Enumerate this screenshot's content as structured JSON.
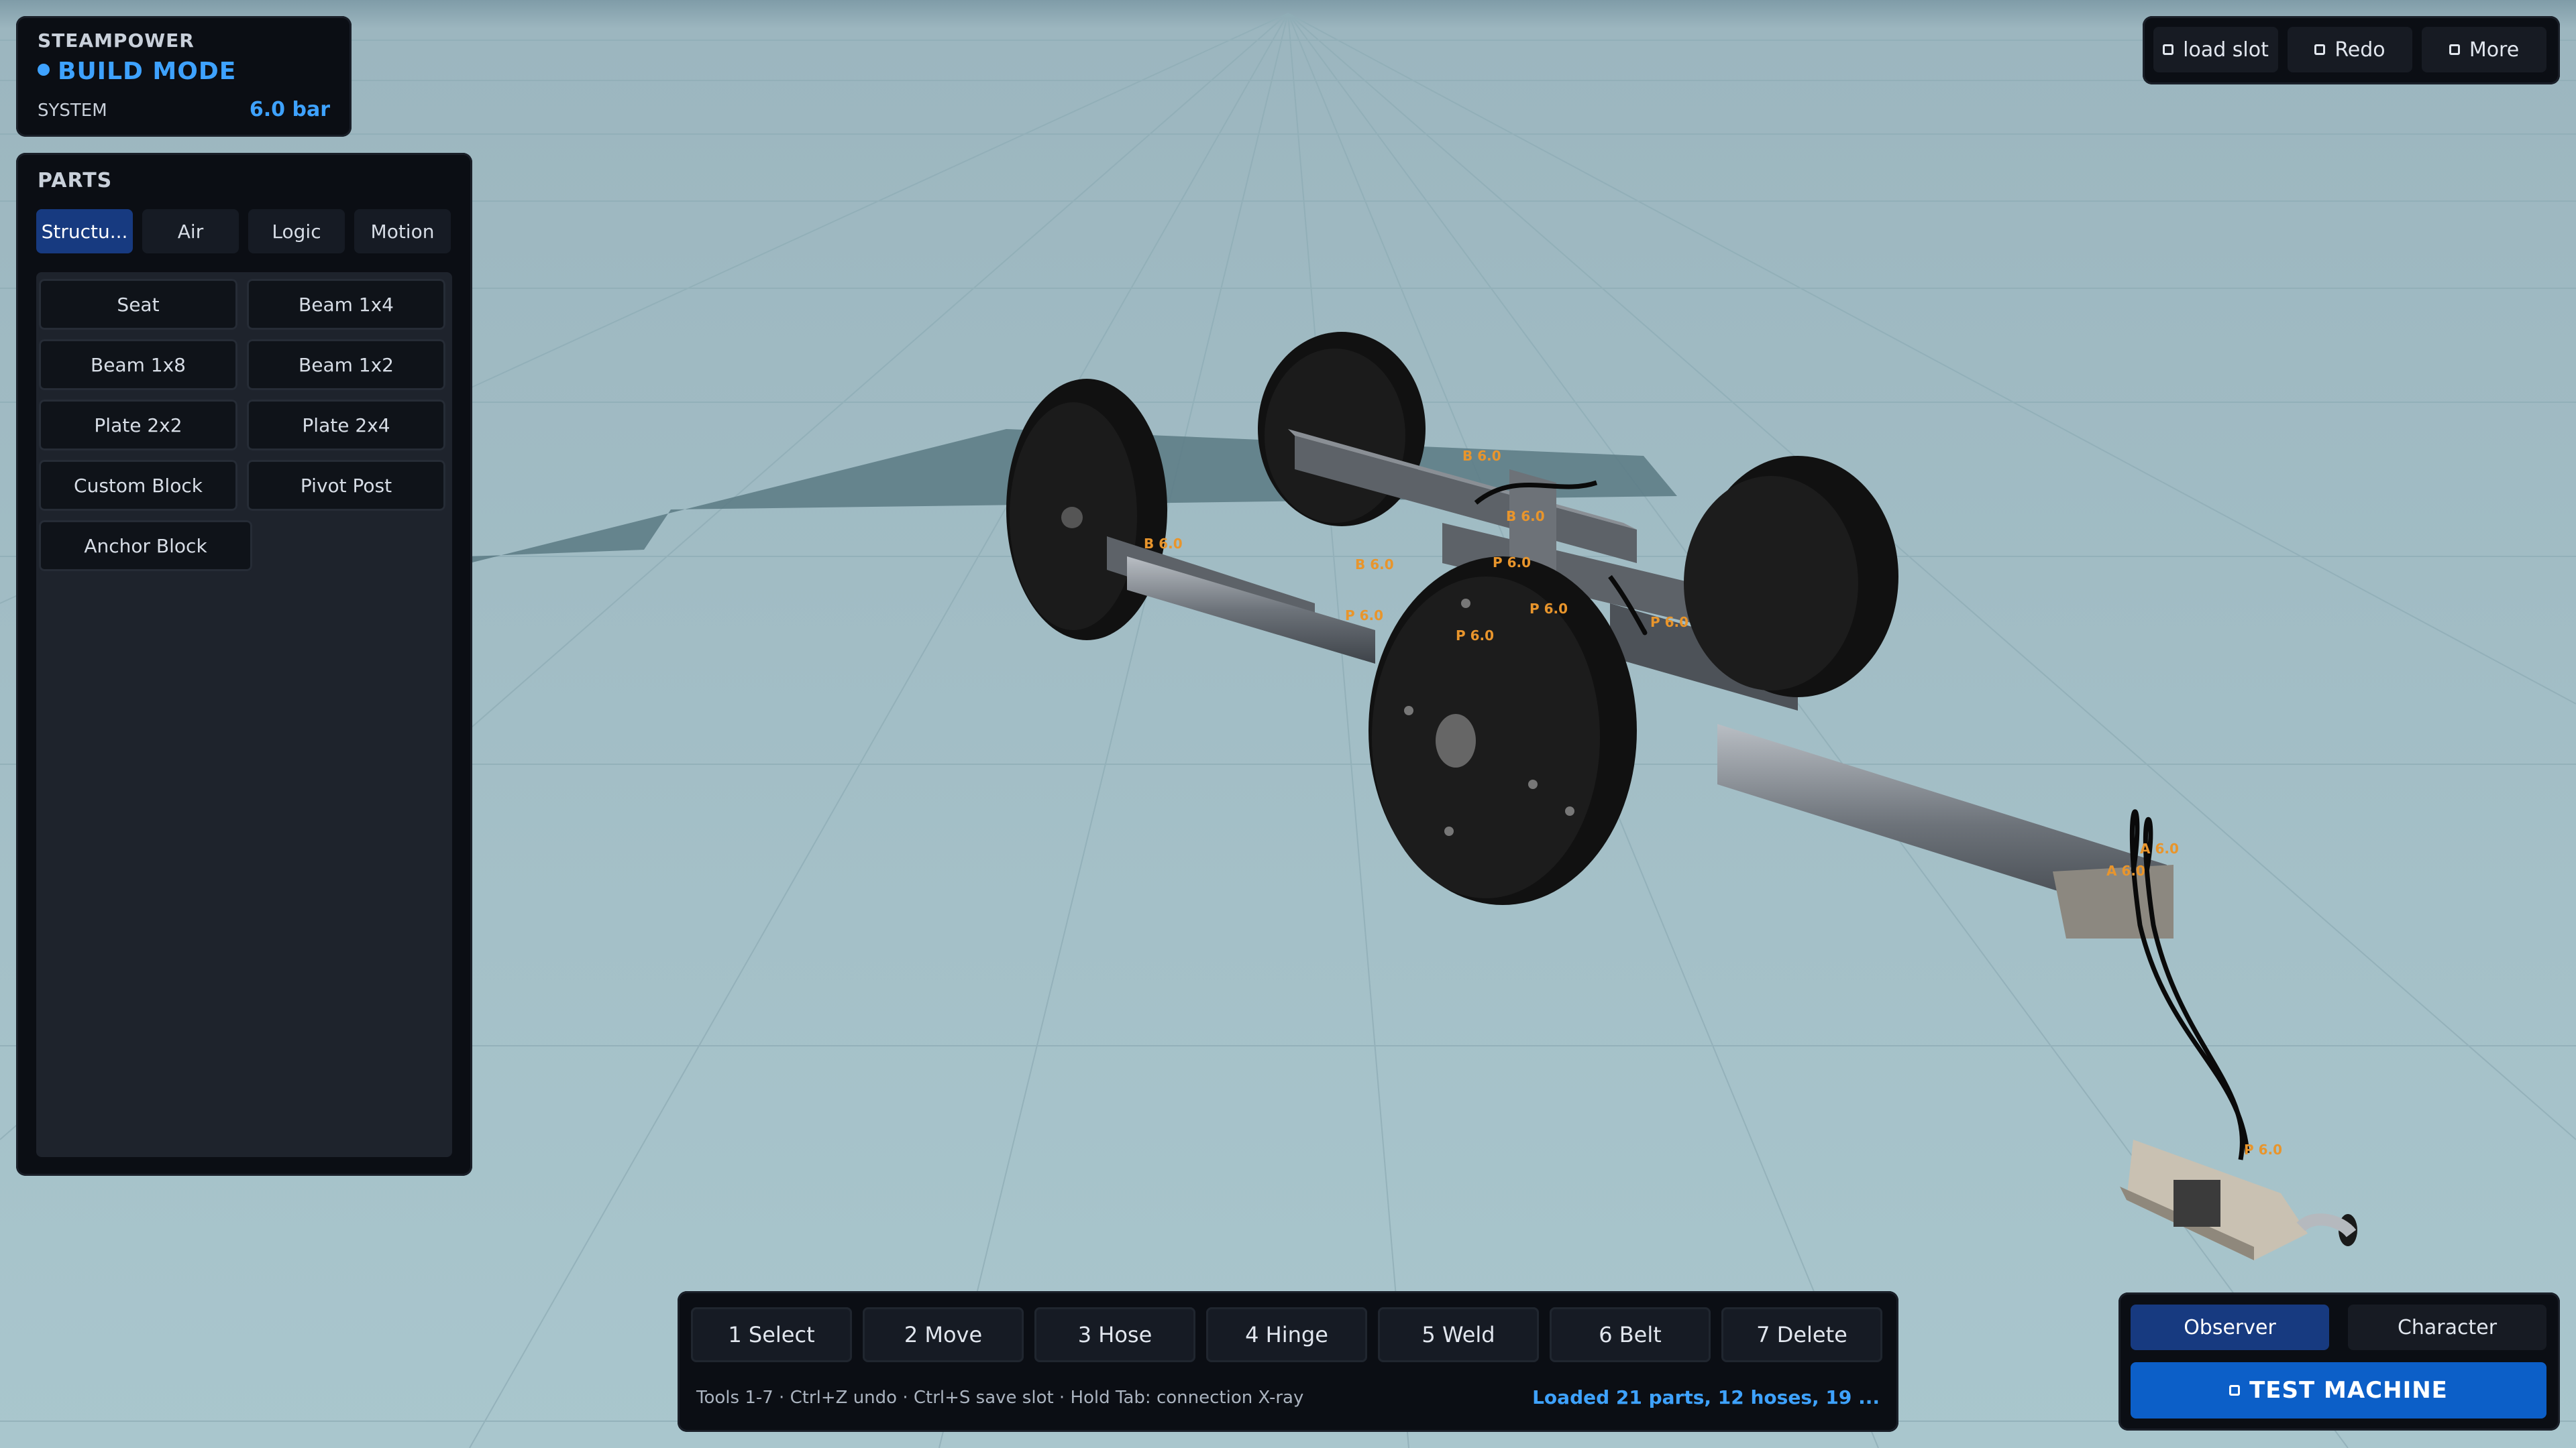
{
  "status": {
    "brand": "STEAMPOWER",
    "mode": "BUILD MODE",
    "system_label": "SYSTEM",
    "system_value": "6.0 bar",
    "accent": "#3ea2ff"
  },
  "parts": {
    "title": "PARTS",
    "tabs": [
      {
        "label": "Structu...",
        "active": true
      },
      {
        "label": "Air",
        "active": false
      },
      {
        "label": "Logic",
        "active": false
      },
      {
        "label": "Motion",
        "active": false
      }
    ],
    "items": [
      "Seat",
      "Beam 1x4",
      "Beam 1x8",
      "Beam 1x2",
      "Plate 2x2",
      "Plate 2x4",
      "Custom Block",
      "Pivot Post",
      "Anchor Block"
    ]
  },
  "topbar": {
    "load_slot": "load slot",
    "redo": "Redo",
    "more": "More"
  },
  "toolbar": {
    "tools": [
      "1  Select",
      "2  Move",
      "3  Hose",
      "4  Hinge",
      "5  Weld",
      "6  Belt",
      "7  Delete"
    ],
    "hint": "Tools 1-7 · Ctrl+Z undo · Ctrl+S save slot · Hold Tab: connection X-ray",
    "loaded": "Loaded 21 parts, 12 hoses, 19 ..."
  },
  "view": {
    "observer": "Observer",
    "character": "Character",
    "test_machine": "TEST MACHINE"
  },
  "scene_tags": [
    "B 6.0",
    "B 6.0",
    "B 6.0",
    "B 6.0",
    "P 6.0",
    "P 6.0",
    "P 6.0",
    "P 6.0",
    "P 6.0",
    "A 6.0",
    "A 6.0",
    "P 6.0"
  ]
}
